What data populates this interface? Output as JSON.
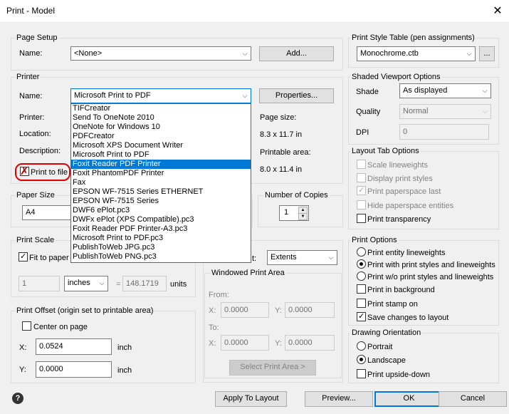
{
  "window": {
    "title": "Print - Model",
    "close_glyph": "✕"
  },
  "page_setup": {
    "group_label": "Page Setup",
    "name_label": "Name:",
    "name_value": "<None>",
    "add_button": "Add..."
  },
  "printer": {
    "group_label": "Printer",
    "name_label": "Name:",
    "name_value": "Microsoft Print to PDF",
    "properties_button": "Properties...",
    "printer_label": "Printer:",
    "location_label": "Location:",
    "description_label": "Description:",
    "print_to_file_label": "Print to file",
    "page_size_label": "Page size:",
    "page_size_value": "8.3 x 11.7 in",
    "printable_area_label": "Printable area:",
    "printable_area_value": "8.0 x 11.4 in",
    "dropdown_items": [
      "TIFCreator",
      "Send To OneNote 2010",
      "OneNote for Windows 10",
      "PDFCreator",
      "Microsoft XPS Document Writer",
      "Microsoft Print to PDF",
      "Foxit Reader PDF Printer",
      "Foxit PhantomPDF Printer",
      "Fax",
      "EPSON WF-7515 Series ETHERNET",
      "EPSON WF-7515 Series",
      "DWF6 ePlot.pc3",
      "DWFx ePlot (XPS Compatible).pc3",
      "Foxit Reader PDF Printer-A3.pc3",
      "Microsoft Print to PDF.pc3",
      "PublishToWeb JPG.pc3",
      "PublishToWeb PNG.pc3"
    ],
    "dropdown_selected": "Foxit Reader PDF Printer"
  },
  "paper_size": {
    "group_label": "Paper Size",
    "value": "A4"
  },
  "copies": {
    "group_label": "Number of Copies",
    "value": "1"
  },
  "print_scale": {
    "group_label": "Print Scale",
    "fit_to_paper_label": "Fit to paper",
    "value1": "1",
    "units_value": "inches",
    "equals": "=",
    "value2": "148.1719",
    "units_label": "units"
  },
  "print_area": {
    "what_to_print_label": "t:",
    "what_to_print_value": "Extents"
  },
  "windowed_area": {
    "group_label": "Windowed Print Area",
    "from_label": "From:",
    "to_label": "To:",
    "x_label": "X:",
    "y_label": "Y:",
    "from_x": "0.0000",
    "from_y": "0.0000",
    "to_x": "0.0000",
    "to_y": "0.0000",
    "select_button": "Select Print Area >"
  },
  "print_offset": {
    "group_label": "Print Offset (origin set to printable area)",
    "center_label": "Center on page",
    "x_label": "X:",
    "y_label": "Y:",
    "x_value": "0.0524",
    "y_value": "0.0000",
    "x_unit": "inch",
    "y_unit": "inch"
  },
  "print_style_table": {
    "group_label": "Print Style Table (pen assignments)",
    "value": "Monochrome.ctb",
    "edit_button": "..."
  },
  "shaded_viewport": {
    "group_label": "Shaded Viewport Options",
    "shade_label": "Shade",
    "shade_value": "As displayed",
    "quality_label": "Quality",
    "quality_value": "Normal",
    "dpi_label": "DPI",
    "dpi_value": "0"
  },
  "layout_tab": {
    "group_label": "Layout Tab Options",
    "scale_lineweights": "Scale lineweights",
    "display_print_styles": "Display print styles",
    "print_paperspace_last": "Print paperspace last",
    "hide_paperspace_entities": "Hide paperspace entities",
    "print_transparency": "Print transparency"
  },
  "print_options": {
    "group_label": "Print Options",
    "entity_lineweights": "Print entity lineweights",
    "with_styles": "Print with print styles and lineweights",
    "without_styles": "Print w/o print styles and lineweights",
    "background": "Print in background",
    "stamp": "Print stamp on",
    "save_changes": "Save changes to layout"
  },
  "orientation": {
    "group_label": "Drawing Orientation",
    "portrait": "Portrait",
    "landscape": "Landscape",
    "upside_down": "Print upside-down"
  },
  "footer": {
    "help_glyph": "?",
    "apply_button": "Apply To Layout",
    "preview_button": "Preview...",
    "ok_button": "OK",
    "cancel_button": "Cancel"
  },
  "colors": {
    "accent": "#0078d7",
    "highlight_ring": "#e00000"
  },
  "glyphs": {
    "combo_arrow": "⌵",
    "spin_up": "▲",
    "spin_down": "▼"
  }
}
